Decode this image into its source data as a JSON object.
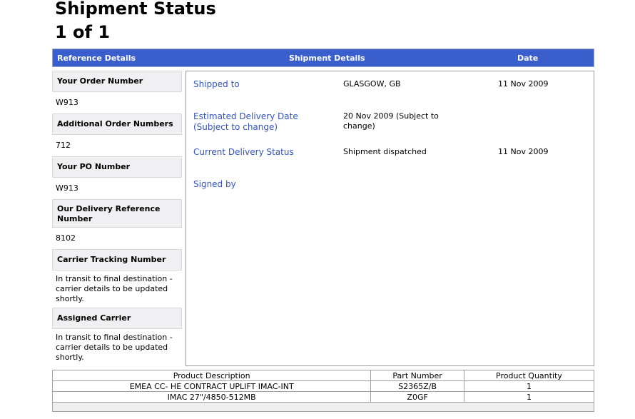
{
  "page": {
    "title": "Shipment Status",
    "counter": "1 of 1"
  },
  "header": {
    "reference_details": "Reference Details",
    "shipment_details": "Shipment Details",
    "date": "Date"
  },
  "colors": {
    "header_bar": "#3a5fcd",
    "label_link": "#3355bb",
    "label_bg": "#f0f0f2"
  },
  "reference": {
    "items": [
      {
        "label": "Your Order Number",
        "value": "W913"
      },
      {
        "label": "Additional Order Numbers",
        "value": "712"
      },
      {
        "label": "Your PO Number",
        "value": "W913"
      },
      {
        "label": "Our Delivery Reference Number",
        "value": "8102"
      },
      {
        "label": "Carrier Tracking Number",
        "value": "In transit to final destination - carrier details to be updated shortly."
      },
      {
        "label": "Assigned Carrier",
        "value": "In transit to final destination - carrier details to be updated shortly."
      }
    ]
  },
  "shipment": {
    "rows": [
      {
        "label": "Shipped to",
        "value": "GLASGOW, GB",
        "date": "11 Nov 2009"
      },
      {
        "label": "Estimated Delivery Date (Subject to change)",
        "value": "20 Nov 2009 (Subject to change)",
        "date": ""
      },
      {
        "label": "Current Delivery Status",
        "value": "Shipment dispatched",
        "date": "11 Nov 2009"
      },
      {
        "label": "Signed by",
        "value": "",
        "date": ""
      }
    ]
  },
  "products": {
    "headers": [
      "Product Description",
      "Part Number",
      "Product Quantity"
    ],
    "rows": [
      {
        "description": "EMEA CC- HE CONTRACT UPLIFT IMAC-INT",
        "part": "S2365Z/B",
        "qty": "1"
      },
      {
        "description": "IMAC 27\"/4850-512MB",
        "part": "Z0GF",
        "qty": "1"
      }
    ]
  }
}
